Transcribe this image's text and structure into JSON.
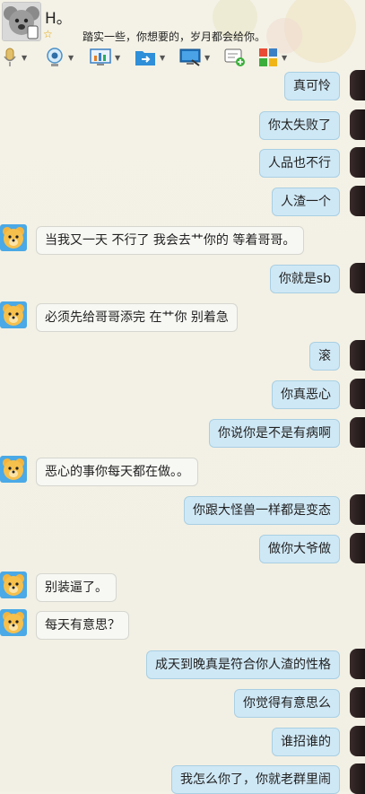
{
  "header": {
    "contact_name": "H。",
    "signature": "踏实一些，你想要的，岁月都会给你。"
  },
  "toolbar": {
    "icons": [
      "microphone-icon",
      "video-call-icon",
      "screen-share-icon",
      "file-transfer-icon",
      "remote-desktop-icon",
      "add-message-icon",
      "apps-grid-icon"
    ]
  },
  "messages": [
    {
      "side": "right",
      "text": "真可怜"
    },
    {
      "side": "right",
      "text": "你太失败了"
    },
    {
      "side": "right",
      "text": "人品也不行"
    },
    {
      "side": "right",
      "text": "人渣一个"
    },
    {
      "side": "left",
      "text": "当我又一天 不行了 我会去艹你的 等着哥哥。"
    },
    {
      "side": "right",
      "text": "你就是sb"
    },
    {
      "side": "left",
      "text": "必须先给哥哥添完 在艹你  别着急"
    },
    {
      "side": "right",
      "text": "滚"
    },
    {
      "side": "right",
      "text": "你真恶心"
    },
    {
      "side": "right",
      "text": "你说你是不是有病啊"
    },
    {
      "side": "left",
      "text": "恶心的事你每天都在做。。"
    },
    {
      "side": "right",
      "text": "你跟大怪兽一样都是变态"
    },
    {
      "side": "right",
      "text": "做你大爷做"
    },
    {
      "side": "left",
      "text": "别装逼了。"
    },
    {
      "side": "left",
      "text": "每天有意思？"
    },
    {
      "side": "right",
      "text": "成天到晚真是符合你人渣的性格"
    },
    {
      "side": "right",
      "text": "你觉得有意思么"
    },
    {
      "side": "right",
      "text": "谁招谁的"
    },
    {
      "side": "right",
      "text": "我怎么你了，你就老群里闹"
    }
  ],
  "colors": {
    "self_bubble": "#cfe8f5",
    "other_bubble": "#f7f7f3",
    "background": "#f3f1e5"
  }
}
